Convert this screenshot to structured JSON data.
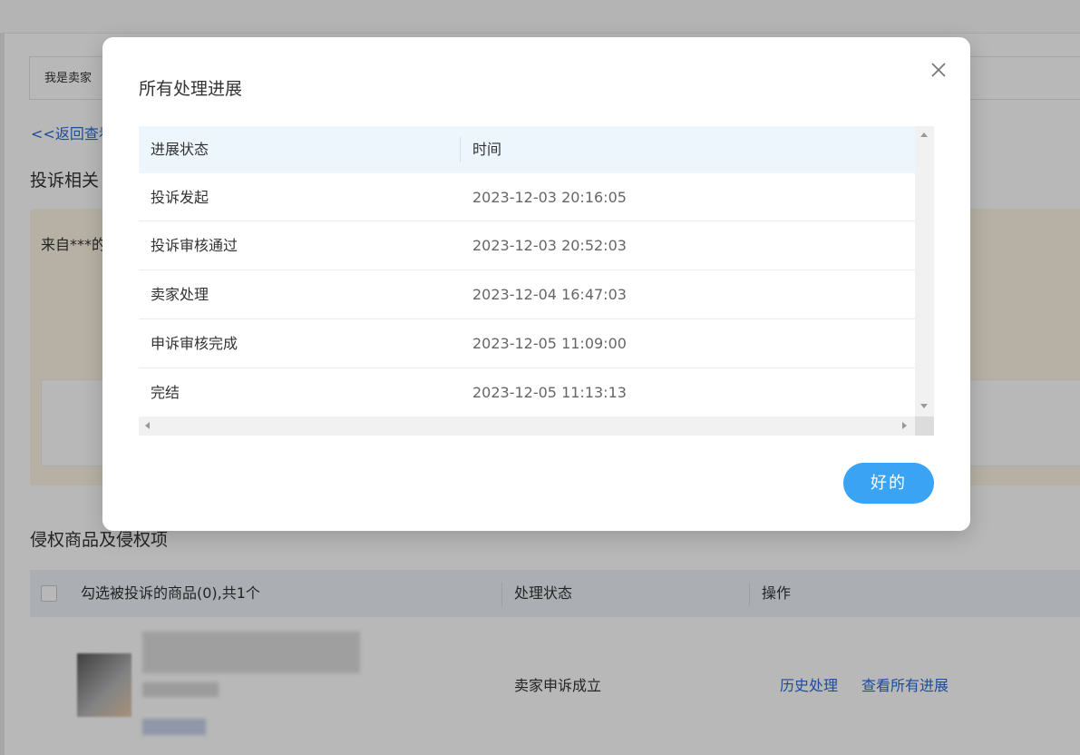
{
  "background": {
    "role_box": "我是卖家",
    "back_link": "<<返回查看",
    "section_complaint": "投诉相关",
    "notice_text": "来自***的",
    "section_goods": "侵权商品及侵权项",
    "goods_table": {
      "headers": [
        "勾选被投诉的商品(0),共1个",
        "处理状态",
        "操作"
      ],
      "row": {
        "status": "卖家申诉成立",
        "actions": [
          "历史处理",
          "查看所有进展"
        ]
      }
    }
  },
  "modal": {
    "title": "所有处理进展",
    "close_icon": "close-icon",
    "table": {
      "headers": [
        "进展状态",
        "时间"
      ],
      "rows": [
        {
          "status": "投诉发起",
          "time": "2023-12-03 20:16:05"
        },
        {
          "status": "投诉审核通过",
          "time": "2023-12-03 20:52:03"
        },
        {
          "status": "卖家处理",
          "time": "2023-12-04 16:47:03"
        },
        {
          "status": "申诉审核完成",
          "time": "2023-12-05 11:09:00"
        },
        {
          "status": "完结",
          "time": "2023-12-05 11:13:13"
        }
      ]
    },
    "ok_button": "好的"
  },
  "colors": {
    "accent": "#3aa3f4",
    "link": "#2a6bd1",
    "table_header_bg": "#edf5fd"
  }
}
